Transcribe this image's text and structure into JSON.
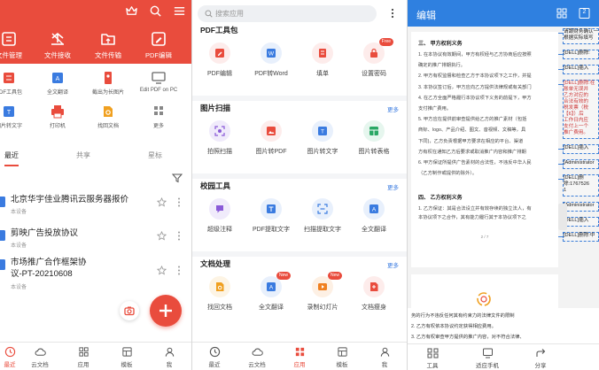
{
  "home": {
    "header_tools": [
      {
        "label": "文件管理",
        "icon": "file-manage-icon"
      },
      {
        "label": "文件接收",
        "icon": "file-receive-icon"
      },
      {
        "label": "文件传输",
        "icon": "file-transfer-icon"
      },
      {
        "label": "PDF编辑",
        "icon": "pdf-edit-icon"
      }
    ],
    "tools": [
      {
        "label": "PDF工具包",
        "icon": "pdf-kit-icon"
      },
      {
        "label": "全文翻译",
        "icon": "translate-icon"
      },
      {
        "label": "截出为长图片",
        "icon": "long-image-icon"
      },
      {
        "label": "Edit PDF on PC",
        "icon": "pc-edit-icon"
      },
      {
        "label": "图片转文字",
        "icon": "image-to-text-icon"
      },
      {
        "label": "打印机",
        "icon": "printer-icon"
      },
      {
        "label": "找回文档",
        "icon": "recover-doc-icon"
      },
      {
        "label": "更多",
        "icon": "more-grid-icon"
      }
    ],
    "tabs": [
      "最近",
      "共享",
      "星标"
    ],
    "files": [
      {
        "title_lines": [
          "北京华宇佳业腾讯云服务器报价"
        ],
        "sub": "本设备"
      },
      {
        "title_lines": [
          "剪映广告投放协议"
        ],
        "sub": "本设备"
      },
      {
        "title_lines": [
          "市场推广合作框架协",
          "议-PT-20210608"
        ],
        "sub": "本设备"
      }
    ],
    "nav": [
      "最近",
      "云文档",
      "应用",
      "模板",
      "我"
    ]
  },
  "apps": {
    "search_placeholder": "搜索应用",
    "more_label": "更多",
    "sections": [
      {
        "title": "PDF工具包",
        "items": [
          {
            "label": "PDF编辑",
            "icon": "pdf-edit-icon",
            "color": "#e94c3d",
            "bg": "#fdeceb"
          },
          {
            "label": "PDF转Word",
            "icon": "pdf-to-word-icon",
            "color": "#3a7be0",
            "bg": "#e8f0fc"
          },
          {
            "label": "填单",
            "icon": "fill-form-icon",
            "color": "#e94c3d",
            "bg": "#fdeceb"
          },
          {
            "label": "设置密码",
            "icon": "lock-icon",
            "color": "#e94c3d",
            "bg": "#fdeceb",
            "badge": "Free"
          }
        ]
      },
      {
        "title": "图片扫描",
        "items": [
          {
            "label": "拍照扫描",
            "icon": "camera-scan-icon",
            "color": "#8a5ad8",
            "bg": "#f0ebfb"
          },
          {
            "label": "图片转PDF",
            "icon": "image-to-pdf-icon",
            "color": "#e94c3d",
            "bg": "#fdeceb"
          },
          {
            "label": "图片转文字",
            "icon": "image-to-text-icon",
            "color": "#3a7be0",
            "bg": "#e8f0fc"
          },
          {
            "label": "图片转表格",
            "icon": "image-to-table-icon",
            "color": "#2aa865",
            "bg": "#e6f6ee"
          }
        ]
      },
      {
        "title": "校园工具",
        "items": [
          {
            "label": "超级注释",
            "icon": "annotate-icon",
            "color": "#8a5ad8",
            "bg": "#f0ebfb"
          },
          {
            "label": "PDF提取文字",
            "icon": "pdf-extract-icon",
            "color": "#3a7be0",
            "bg": "#e8f0fc"
          },
          {
            "label": "扫描提取文字",
            "icon": "scan-extract-icon",
            "color": "#3a7be0",
            "bg": "#e8f0fc"
          },
          {
            "label": "全文翻译",
            "icon": "translate-icon",
            "color": "#3a7be0",
            "bg": "#e8f0fc"
          }
        ]
      },
      {
        "title": "文档处理",
        "items": [
          {
            "label": "找回文档",
            "icon": "recover-doc-icon",
            "color": "#f0a020",
            "bg": "#fdf4e4"
          },
          {
            "label": "全文翻译",
            "icon": "translate-icon",
            "color": "#3a7be0",
            "bg": "#e8f0fc",
            "badge": "New"
          },
          {
            "label": "录制幻灯片",
            "icon": "record-slides-icon",
            "color": "#f08020",
            "bg": "#fdf0e4",
            "badge": "New"
          },
          {
            "label": "文档瘦身",
            "icon": "slim-doc-icon",
            "color": "#e94c3d",
            "bg": "#fdeceb"
          }
        ]
      }
    ],
    "nav": [
      "最近",
      "云文档",
      "应用",
      "模板",
      "我"
    ]
  },
  "editor": {
    "title": "编辑",
    "page_badge": "2",
    "page_number": "2 / 7",
    "doc_heading": "三、    甲方权利义务",
    "doc_lines": [
      "1.  在本协议有效期间，甲方有权经与乙方协商后应按照",
      "     确定的推广排期执行。",
      "2.  甲方有权监督和检查乙方于本协议项下之工作，并提",
      "3.  本协议签订后，甲方应向乙方提供法律规或有关部门",
      "4.  在乙方全面严格履行本协议项下义务的前提下，甲方",
      "     支付推广费用。",
      "5.  甲方应在提供前审查提供给乙方的推广素材（包括",
      "     商标、logo、产品介绍、图文、音视频、文稿等，具",
      "     下同)，乙方负责根据甲方要求在相应的平台、渠道",
      "     方有权在通知乙方后要求或取消推广内容和推广排期",
      "6.  甲方保证所提供广告素材的合法性，不违反中华人民",
      "     （乙方制作或提供的除外）。"
    ],
    "section_four": "四、    乙方权利义务",
    "section_four_lines": [
      "1.  乙方保证：其是合法设立并有效存续的独立法人，有",
      "     本协议项下之合作，其有能力履行其于本协议项下之"
    ],
    "bottom_lines": [
      "务的行为不违反任何其有约束力的法律文件的限制",
      "2.  乙方有权依本协议约定获得相应费用。",
      "3.  乙方有权审查甲方提供的推广内容，对不符合法律、"
    ],
    "comments": [
      {
        "lines": [
          "请跟财务确认一",
          "根据实际填写"
        ],
        "red": false
      },
      {
        "lines": [
          "[DELL]删除:"
        ],
        "red": false
      },
      {
        "lines": [
          "[DELL]插入"
        ],
        "red": false
      },
      {
        "lines": [
          "[DELL]删除:在",
          "账单无误并",
          "乙方对应的",
          "合法有效的",
          "税发票（税",
          "【6】）后",
          "工作日内应",
          "支付上一个",
          "推广费用。"
        ],
        "red": true
      },
      {
        "lines": [
          "[DELL]插入"
        ],
        "red": false
      },
      {
        "lines": [
          "[Administrator"
        ],
        "red": false
      },
      {
        "lines": [
          "[DELL]删",
          "除:1767526",
          "1"
        ],
        "red": false
      },
      {
        "lines": [
          "[Administrator"
        ],
        "red": false
      },
      {
        "lines": [
          "[DELL]插入"
        ],
        "red": false
      },
      {
        "lines": [
          "[DELL]删除:中"
        ],
        "red": false
      }
    ],
    "nav": [
      {
        "label": "工具",
        "icon": "tools-grid-icon"
      },
      {
        "label": "适应手机",
        "icon": "fit-phone-icon"
      },
      {
        "label": "分享",
        "icon": "share-icon"
      }
    ]
  }
}
